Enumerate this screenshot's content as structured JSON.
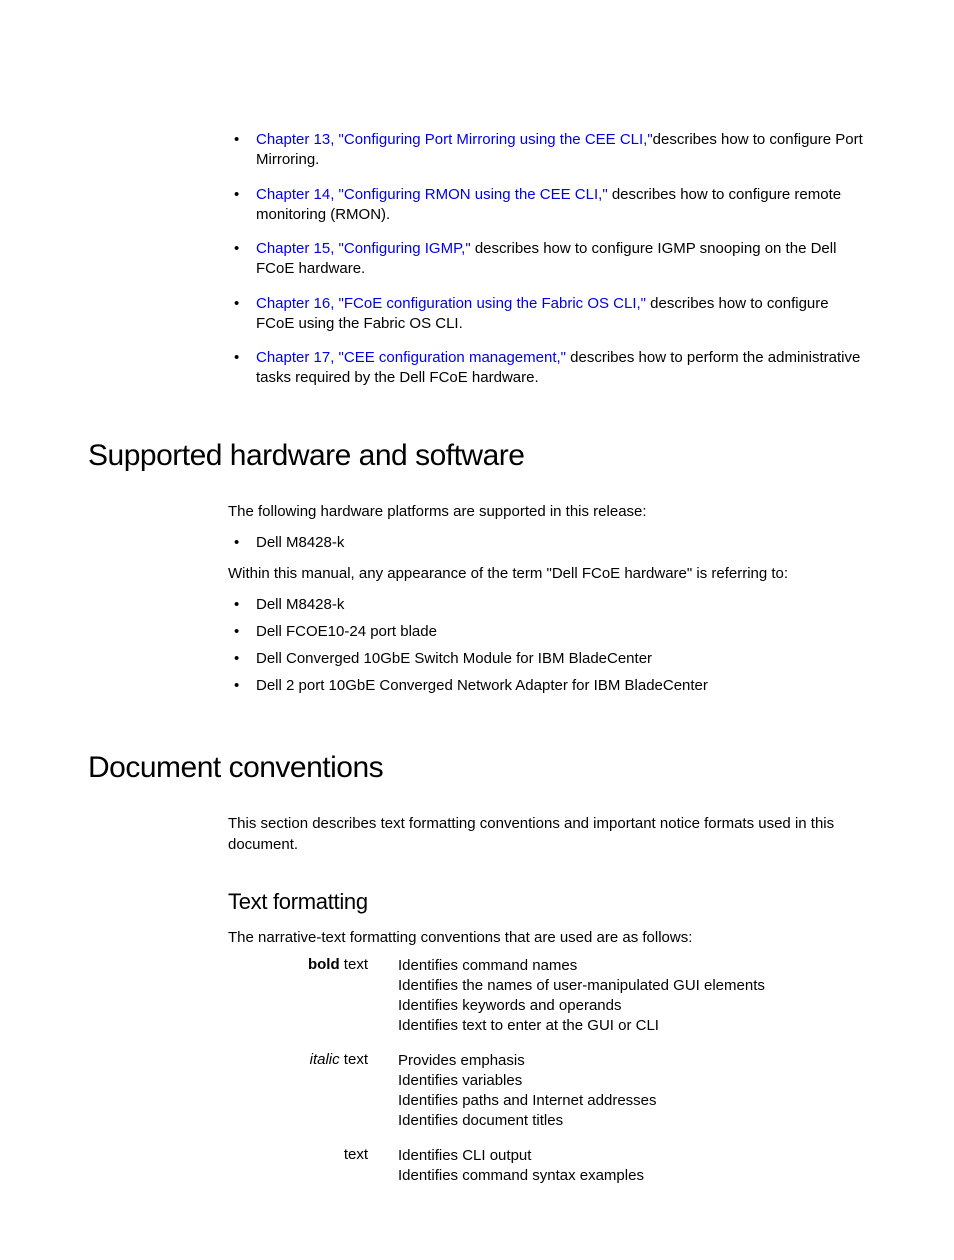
{
  "chapters": [
    {
      "link": "Chapter 13, \"Configuring Port Mirroring using the CEE CLI,\"",
      "desc": "describes how to configure Port Mirroring."
    },
    {
      "link": "Chapter 14, \"Configuring RMON using the CEE CLI,\"",
      "desc": " describes how to configure remote monitoring (RMON)."
    },
    {
      "link": "Chapter 15, \"Configuring IGMP,\"",
      "desc": " describes how to configure IGMP snooping on the Dell FCoE hardware."
    },
    {
      "link": "Chapter 16, \"FCoE configuration using the Fabric OS CLI,\"",
      "desc": " describes how to configure FCoE using the Fabric OS CLI."
    },
    {
      "link": "Chapter 17, \"CEE configuration management,\"",
      "desc": " describes how to perform the administrative tasks required by the Dell FCoE hardware."
    }
  ],
  "hw": {
    "heading": "Supported hardware and software",
    "intro": "The following hardware platforms are supported in this release:",
    "platforms": [
      "Dell M8428-k"
    ],
    "term_intro": "Within this manual, any appearance of the term \"Dell FCoE hardware\" is referring to:",
    "refers": [
      "Dell M8428-k",
      "Dell FCOE10-24 port blade",
      "Dell Converged 10GbE Switch Module for IBM BladeCenter",
      "Dell 2 port 10GbE Converged Network Adapter for IBM BladeCenter"
    ]
  },
  "conv": {
    "heading": "Document conventions",
    "intro": "This section describes text formatting conventions and important notice formats used in this document.",
    "sub": "Text formatting",
    "sub_intro": "The narrative-text formatting conventions that are used are as follows:",
    "rows": [
      {
        "label_prefix": "bold",
        "label_suffix": " text",
        "label_style": "bold",
        "lines": [
          "Identifies command names",
          "Identifies the names of user-manipulated GUI elements",
          "Identifies keywords and operands",
          "Identifies text to enter at the GUI or CLI"
        ]
      },
      {
        "label_prefix": "italic",
        "label_suffix": " text",
        "label_style": "italic",
        "lines": [
          "Provides emphasis",
          "Identifies variables",
          "Identifies paths and Internet addresses",
          "Identifies document titles"
        ]
      },
      {
        "label_prefix": "",
        "label_suffix": "text",
        "label_style": "",
        "lines": [
          "Identifies CLI output",
          "Identifies command syntax examples"
        ]
      }
    ]
  }
}
